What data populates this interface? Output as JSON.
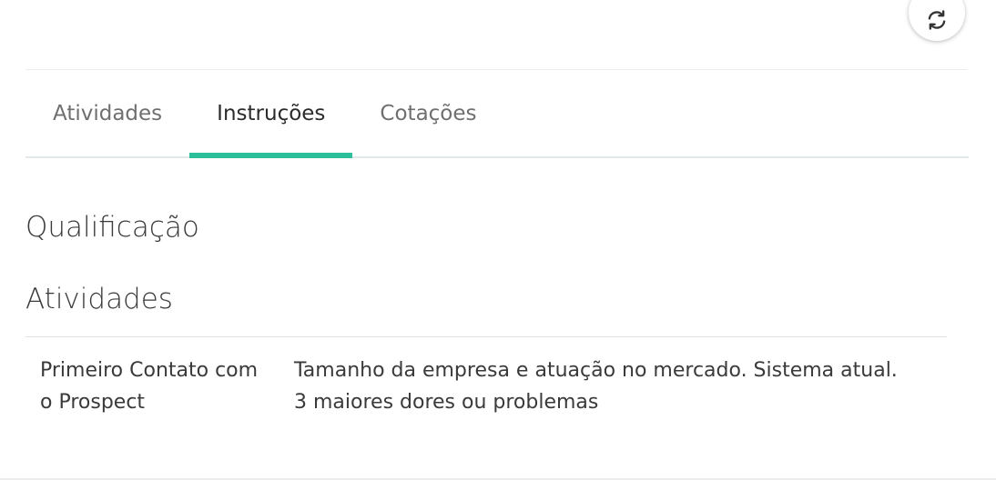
{
  "toolbar": {
    "refresh_icon": "refresh-icon"
  },
  "tabs": [
    {
      "label": "Atividades",
      "active": false
    },
    {
      "label": "Instruções",
      "active": true
    },
    {
      "label": "Cotações",
      "active": false
    }
  ],
  "colors": {
    "accent": "#2bbf9a"
  },
  "instructions": {
    "section_title": "Qualificação",
    "activities_title": "Atividades",
    "rows": [
      {
        "name": "Primeiro Contato com o Prospect",
        "description": "Tamanho da empresa e atuação no mercado. Sistema atual. 3 maiores dores ou problemas"
      }
    ]
  }
}
